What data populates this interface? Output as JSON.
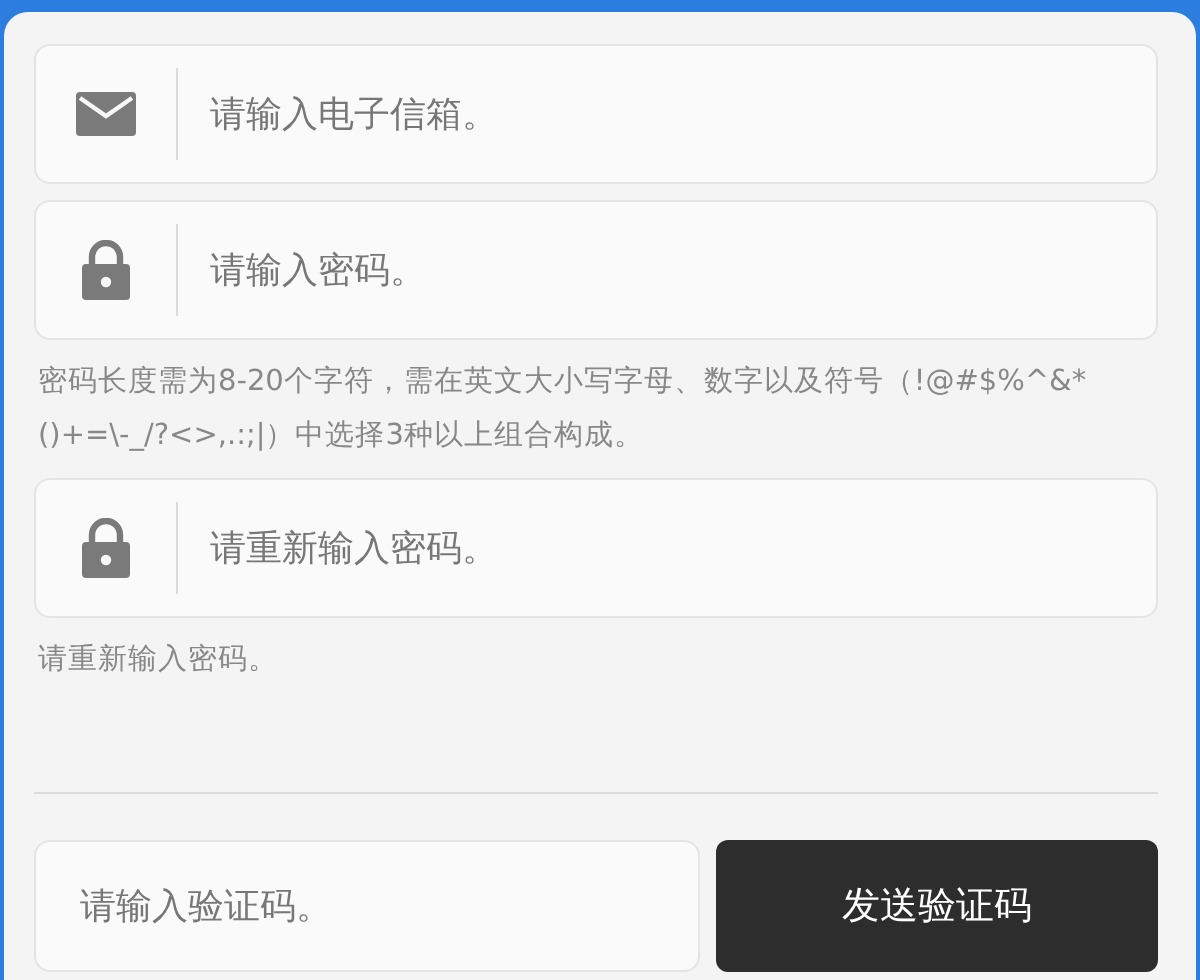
{
  "fields": [
    {
      "kind": "email",
      "placeholder": "请输入电子信箱。"
    },
    {
      "kind": "password",
      "placeholder": "请输入密码。",
      "hint": "密码长度需为8-20个字符，需在英文大小写字母、数字以及符号（!@#$%^&*()+=\\-_/?<>,.:;|）中选择3种以上组合构成。"
    },
    {
      "kind": "password",
      "placeholder": "请重新输入密码。",
      "hint": "请重新输入密码。"
    }
  ],
  "verification": {
    "placeholder": "请输入验证码。",
    "button": "发送验证码"
  }
}
